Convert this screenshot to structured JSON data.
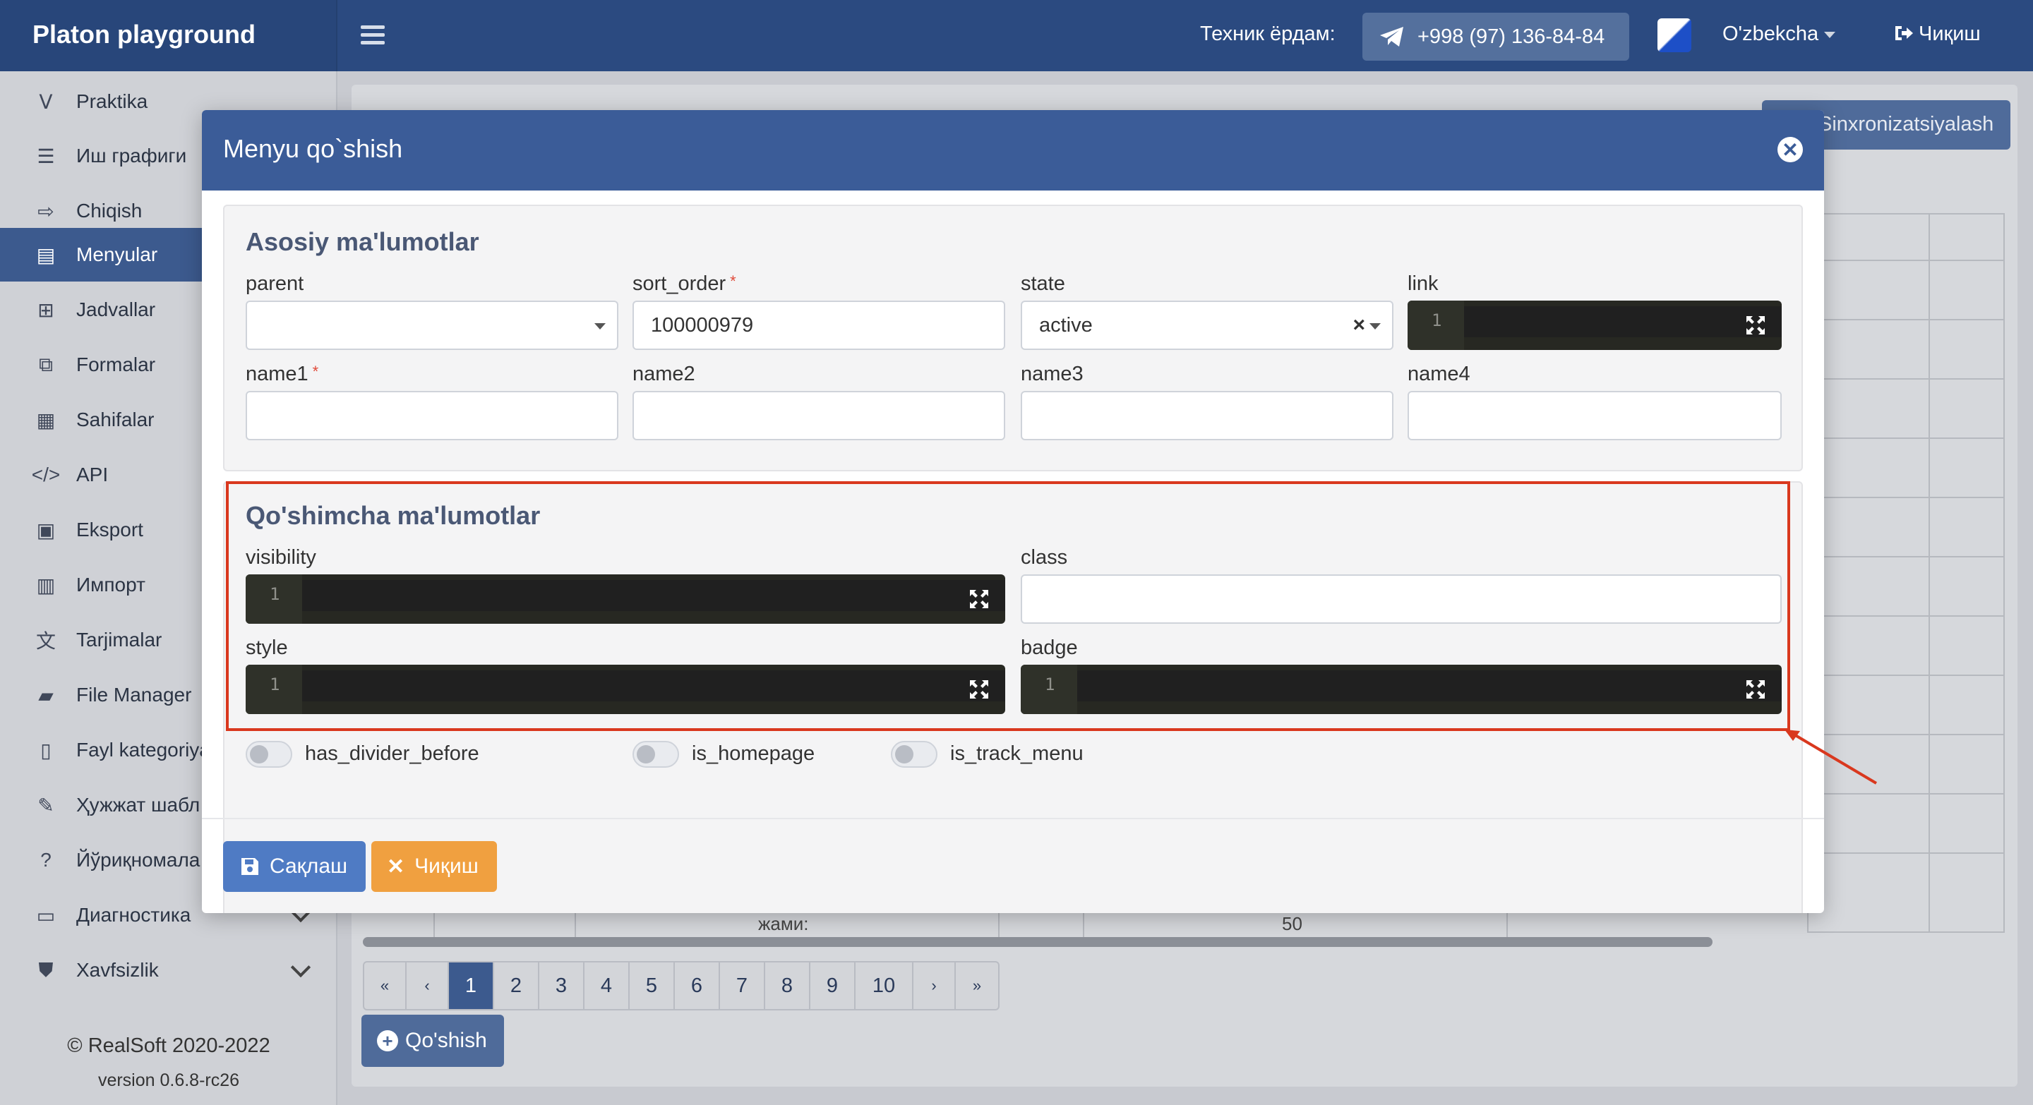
{
  "app": {
    "brand": "Platon playground"
  },
  "topbar": {
    "help_label": "Техник ёрдам:",
    "phone": "+998 (97) 136-84-84",
    "language": "O'zbekcha",
    "exit": "Чиқиш"
  },
  "sidebar": {
    "items": [
      {
        "label": "Praktika",
        "icon": "praktika-icon"
      },
      {
        "label": "Иш графиги",
        "icon": "list-icon"
      },
      {
        "label": "Chiqish",
        "icon": "sign-out-icon"
      },
      {
        "label": "Menyular",
        "icon": "menu-table-icon",
        "active": true
      },
      {
        "label": "Jadvallar",
        "icon": "grid-icon"
      },
      {
        "label": "Formalar",
        "icon": "window-icon"
      },
      {
        "label": "Sahifalar",
        "icon": "pages-icon"
      },
      {
        "label": "API",
        "icon": "code-icon"
      },
      {
        "label": "Eksport",
        "icon": "excel-icon"
      },
      {
        "label": "Импорт",
        "icon": "import-icon"
      },
      {
        "label": "Tarjimalar",
        "icon": "translate-icon"
      },
      {
        "label": "File Manager",
        "icon": "folder-icon"
      },
      {
        "label": "Fayl kategoriya",
        "icon": "file-icon"
      },
      {
        "label": "Ҳужжат шабл",
        "icon": "file-signature-icon"
      },
      {
        "label": "Йўриқномала",
        "icon": "question-icon"
      },
      {
        "label": "Диагностика",
        "icon": "laptop-icon"
      },
      {
        "label": "Xavfsizlik",
        "icon": "shield-icon"
      }
    ],
    "footer": "© RealSoft 2020-2022",
    "version": "version 0.6.8-rc26"
  },
  "background": {
    "sync_button": "Sinxronizatsiyalash",
    "total_label": "жами:",
    "total_value": "50",
    "pagination": [
      "«",
      "‹",
      "1",
      "2",
      "3",
      "4",
      "5",
      "6",
      "7",
      "8",
      "9",
      "10",
      "›",
      "»"
    ],
    "active_page": "1",
    "add_button": "Qo'shish"
  },
  "modal": {
    "title": "Menyu qo`shish",
    "main_section": {
      "title": "Asosiy ma'lumotlar",
      "fields": {
        "parent": {
          "label": "parent",
          "value": ""
        },
        "sort_order": {
          "label": "sort_order",
          "value": "100000979",
          "required": "*"
        },
        "state": {
          "label": "state",
          "value": "active"
        },
        "link": {
          "label": "link",
          "line_number": "1"
        },
        "name1": {
          "label": "name1",
          "value": "",
          "required": "*"
        },
        "name2": {
          "label": "name2",
          "value": ""
        },
        "name3": {
          "label": "name3",
          "value": ""
        },
        "name4": {
          "label": "name4",
          "value": ""
        }
      }
    },
    "extra_section": {
      "title": "Qo'shimcha ma'lumotlar",
      "fields": {
        "visibility": {
          "label": "visibility",
          "line_number": "1"
        },
        "class": {
          "label": "class",
          "value": ""
        },
        "style": {
          "label": "style",
          "line_number": "1"
        },
        "badge": {
          "label": "badge",
          "line_number": "1"
        }
      }
    },
    "toggles": {
      "has_divider_before": {
        "label": "has_divider_before",
        "on": false
      },
      "is_homepage": {
        "label": "is_homepage",
        "on": false
      },
      "is_track_menu": {
        "label": "is_track_menu",
        "on": false
      }
    },
    "buttons": {
      "save": "Сақлаш",
      "cancel": "Чиқиш"
    }
  },
  "colors": {
    "navbar": "#2b4a80",
    "modal_header": "#3b5c98",
    "save_button": "#4f7bc4",
    "cancel_button": "#f0a040",
    "highlight": "#d9381e",
    "code_editor": "#272822"
  }
}
